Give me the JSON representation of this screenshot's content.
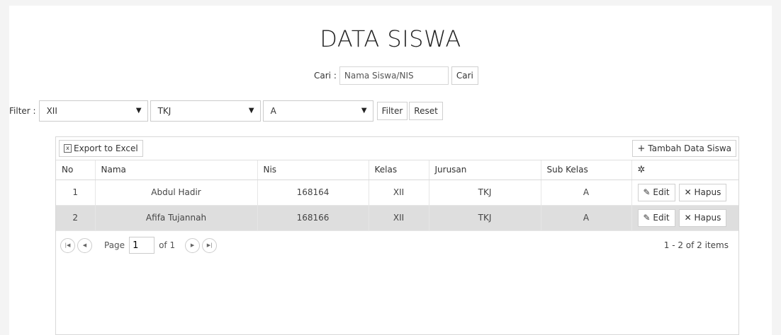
{
  "page": {
    "title": "DATA SISWA"
  },
  "search": {
    "label": "Cari :",
    "placeholder": "Nama Siswa/NIS",
    "button": "Cari"
  },
  "filter": {
    "label": "Filter :",
    "kelas": "XII",
    "jurusan": "TKJ",
    "sub_kelas": "A",
    "filter_button": "Filter",
    "reset_button": "Reset"
  },
  "toolbar": {
    "export_label": "Export to Excel",
    "add_label": "Tambah Data Siswa"
  },
  "table": {
    "headers": {
      "no": "No",
      "nama": "Nama",
      "nis": "Nis",
      "kelas": "Kelas",
      "jurusan": "Jurusan",
      "sub_kelas": "Sub Kelas"
    },
    "rows": [
      {
        "no": "1",
        "nama": "Abdul Hadir",
        "nis": "168164",
        "kelas": "XII",
        "jurusan": "TKJ",
        "sub_kelas": "A"
      },
      {
        "no": "2",
        "nama": "Afifa Tujannah",
        "nis": "168166",
        "kelas": "XII",
        "jurusan": "TKJ",
        "sub_kelas": "A"
      }
    ],
    "edit_label": "Edit",
    "delete_label": "Hapus"
  },
  "pager": {
    "page_label": "Page",
    "page_value": "1",
    "of_label": "of 1",
    "info": "1 - 2 of 2 items"
  }
}
